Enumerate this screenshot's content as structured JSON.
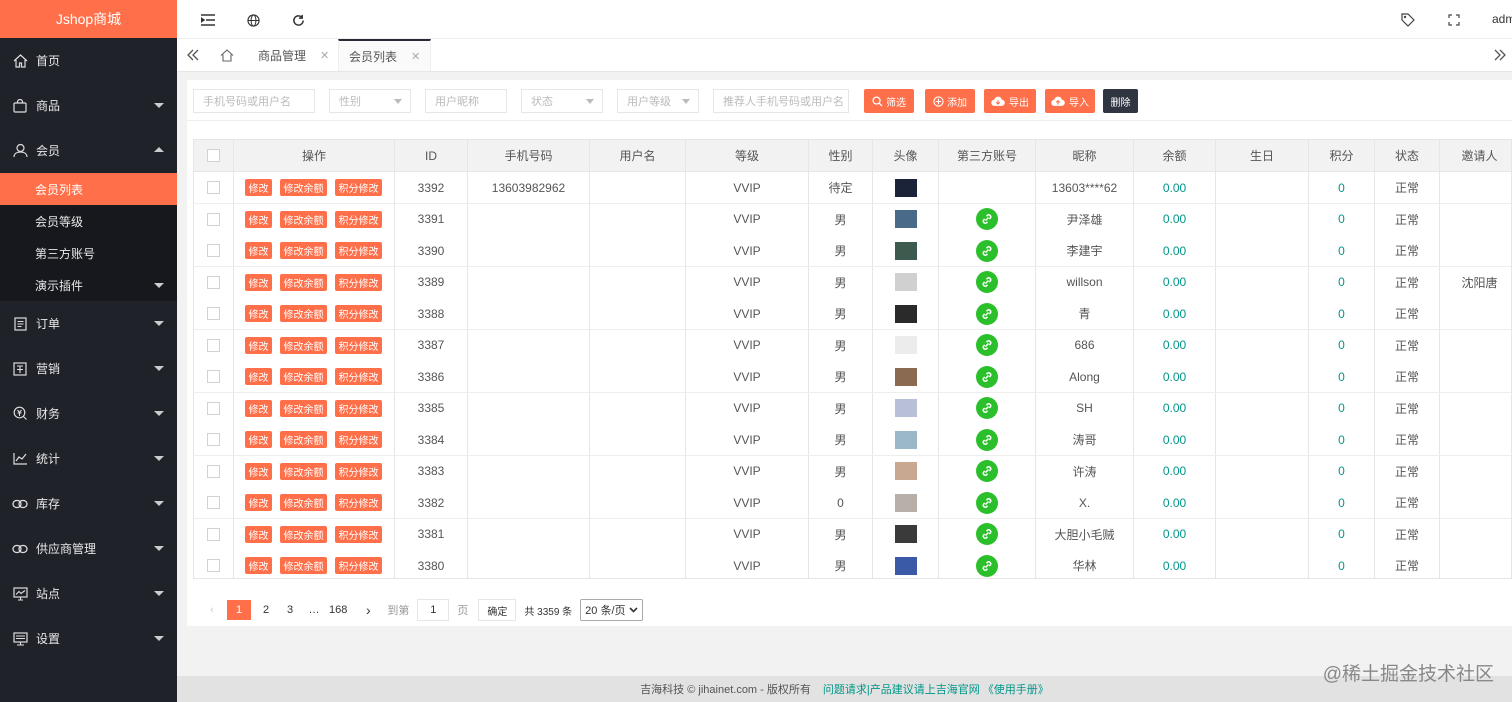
{
  "app": {
    "logo": "Jshop商城",
    "user": "admin"
  },
  "sidebar": {
    "items": [
      {
        "label": "首页",
        "icon": "home-icon"
      },
      {
        "label": "商品",
        "icon": "bag-icon"
      },
      {
        "label": "会员",
        "icon": "user-icon"
      },
      {
        "label": "订单",
        "icon": "order-icon"
      },
      {
        "label": "营销",
        "icon": "promo-icon"
      },
      {
        "label": "财务",
        "icon": "finance-icon"
      },
      {
        "label": "统计",
        "icon": "stats-icon"
      },
      {
        "label": "库存",
        "icon": "link-icon"
      },
      {
        "label": "供应商管理",
        "icon": "link-icon"
      },
      {
        "label": "站点",
        "icon": "site-icon"
      },
      {
        "label": "设置",
        "icon": "settings-icon"
      }
    ],
    "sub_items": [
      "会员列表",
      "会员等级",
      "第三方账号",
      "演示插件"
    ]
  },
  "tabs": [
    {
      "label": "商品管理"
    },
    {
      "label": "会员列表"
    }
  ],
  "filters": {
    "phone_placeholder": "手机号码或用户名",
    "gender": "性别",
    "nickname_placeholder": "用户昵称",
    "status": "状态",
    "level": "用户等级",
    "referrer_placeholder": "推荐人手机号码或用户名",
    "btn_filter": "筛选",
    "btn_add": "添加",
    "btn_export": "导出",
    "btn_import": "导入",
    "btn_delete": "删除"
  },
  "table": {
    "headers": [
      "",
      "操作",
      "ID",
      "手机号码",
      "用户名",
      "等级",
      "性别",
      "头像",
      "第三方账号",
      "昵称",
      "余额",
      "生日",
      "积分",
      "状态",
      "邀请人"
    ],
    "op_labels": [
      "修改",
      "修改余额",
      "积分修改"
    ],
    "rows": [
      {
        "id": "3392",
        "phone": "13603982962",
        "username": "",
        "level": "VVIP",
        "gender": "待定",
        "avatar": "#1a2338",
        "wx": false,
        "nickname": "13603****62",
        "balance": "0.00",
        "birthday": "",
        "points": "0",
        "status": "正常",
        "inviter": ""
      },
      {
        "id": "3391",
        "phone": "",
        "username": "",
        "level": "VVIP",
        "gender": "男",
        "avatar": "#4a6a8a",
        "wx": true,
        "nickname": "尹泽雄",
        "balance": "0.00",
        "birthday": "",
        "points": "0",
        "status": "正常",
        "inviter": ""
      },
      {
        "id": "3390",
        "phone": "",
        "username": "",
        "level": "VVIP",
        "gender": "男",
        "avatar": "#3d5a4e",
        "wx": true,
        "nickname": "李建宇",
        "balance": "0.00",
        "birthday": "",
        "points": "0",
        "status": "正常",
        "inviter": ""
      },
      {
        "id": "3389",
        "phone": "",
        "username": "",
        "level": "VVIP",
        "gender": "男",
        "avatar": "#d0d0d0",
        "wx": true,
        "nickname": "willson",
        "balance": "0.00",
        "birthday": "",
        "points": "0",
        "status": "正常",
        "inviter": "沈阳唐"
      },
      {
        "id": "3388",
        "phone": "",
        "username": "",
        "level": "VVIP",
        "gender": "男",
        "avatar": "#2a2a2a",
        "wx": true,
        "nickname": "青",
        "balance": "0.00",
        "birthday": "",
        "points": "0",
        "status": "正常",
        "inviter": ""
      },
      {
        "id": "3387",
        "phone": "",
        "username": "",
        "level": "VVIP",
        "gender": "男",
        "avatar": "#ececec",
        "wx": true,
        "nickname": "686",
        "balance": "0.00",
        "birthday": "",
        "points": "0",
        "status": "正常",
        "inviter": ""
      },
      {
        "id": "3386",
        "phone": "",
        "username": "",
        "level": "VVIP",
        "gender": "男",
        "avatar": "#8a6a50",
        "wx": true,
        "nickname": "Along",
        "balance": "0.00",
        "birthday": "",
        "points": "0",
        "status": "正常",
        "inviter": ""
      },
      {
        "id": "3385",
        "phone": "",
        "username": "",
        "level": "VVIP",
        "gender": "男",
        "avatar": "#b8c0d8",
        "wx": true,
        "nickname": "SH",
        "balance": "0.00",
        "birthday": "",
        "points": "0",
        "status": "正常",
        "inviter": ""
      },
      {
        "id": "3384",
        "phone": "",
        "username": "",
        "level": "VVIP",
        "gender": "男",
        "avatar": "#9ab8c8",
        "wx": true,
        "nickname": "涛哥",
        "balance": "0.00",
        "birthday": "",
        "points": "0",
        "status": "正常",
        "inviter": ""
      },
      {
        "id": "3383",
        "phone": "",
        "username": "",
        "level": "VVIP",
        "gender": "男",
        "avatar": "#c8a890",
        "wx": true,
        "nickname": "许涛",
        "balance": "0.00",
        "birthday": "",
        "points": "0",
        "status": "正常",
        "inviter": ""
      },
      {
        "id": "3382",
        "phone": "",
        "username": "",
        "level": "VVIP",
        "gender": "0",
        "avatar": "#b8b0a8",
        "wx": true,
        "nickname": "X.",
        "balance": "0.00",
        "birthday": "",
        "points": "0",
        "status": "正常",
        "inviter": ""
      },
      {
        "id": "3381",
        "phone": "",
        "username": "",
        "level": "VVIP",
        "gender": "男",
        "avatar": "#3a3a3a",
        "wx": true,
        "nickname": "大胆小毛贼",
        "balance": "0.00",
        "birthday": "",
        "points": "0",
        "status": "正常",
        "inviter": ""
      },
      {
        "id": "3380",
        "phone": "",
        "username": "",
        "level": "VVIP",
        "gender": "男",
        "avatar": "#3a5aa8",
        "wx": true,
        "nickname": "华林",
        "balance": "0.00",
        "birthday": "",
        "points": "0",
        "status": "正常",
        "inviter": ""
      }
    ]
  },
  "pager": {
    "pages": [
      "1",
      "2",
      "3",
      "…",
      "168"
    ],
    "goto_prefix": "到第",
    "goto_value": "1",
    "goto_suffix": "页",
    "confirm": "确定",
    "total": "共 3359 条",
    "page_size": "20 条/页"
  },
  "footer": {
    "copyright": "吉海科技 © jihainet.com - 版权所有",
    "links": "问题请求|产品建议请上吉海官网 《使用手册》"
  },
  "watermark": "@稀土掘金技术社区"
}
